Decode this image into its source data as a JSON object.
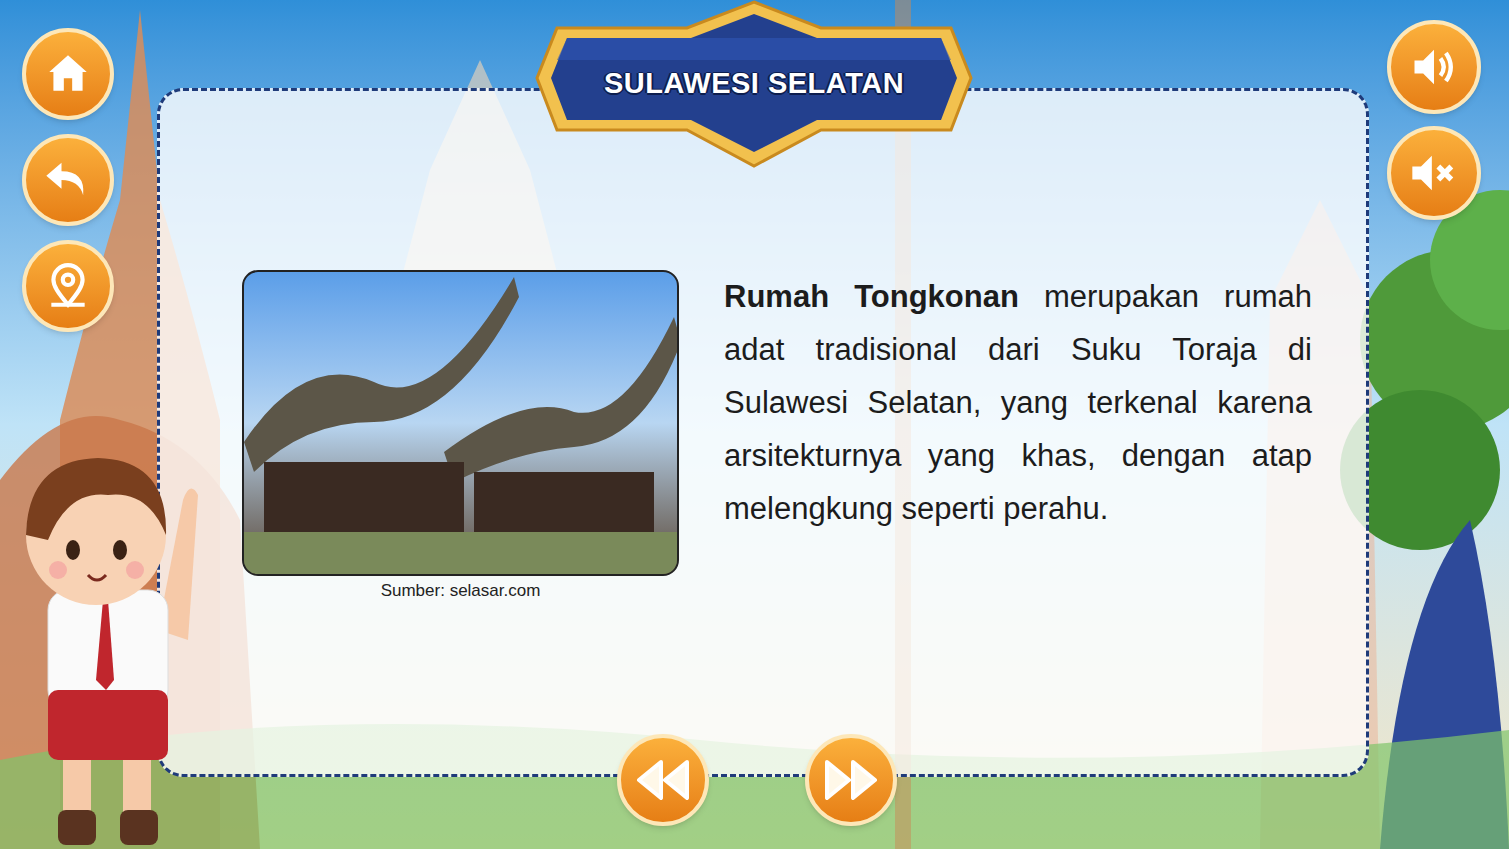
{
  "header": {
    "title": "SULAWESI SELATAN"
  },
  "content": {
    "photo_caption": "Sumber: selasar.com",
    "term": "Rumah Tongkonan",
    "description": "merupakan rumah adat tradisional dari Suku Toraja di Sulawesi Selatan, yang terkenal karena arsitekturnya yang khas, dengan atap melengkung seperti perahu."
  }
}
